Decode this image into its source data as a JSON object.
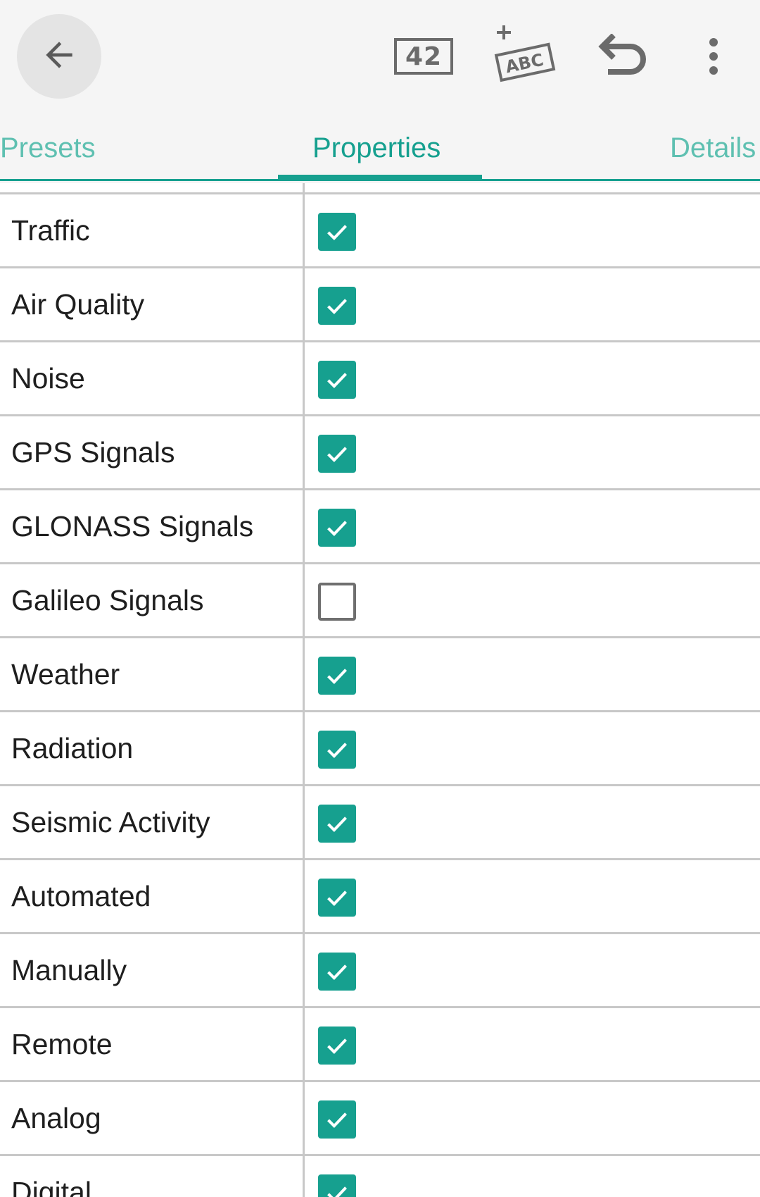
{
  "toolbar": {
    "back_icon": "arrow-left-icon",
    "number_badge": "42",
    "add_label_text": "ABC",
    "add_label_icon": "add-text-icon",
    "undo_icon": "undo-icon",
    "overflow_icon": "more-vert-icon"
  },
  "tabs": [
    {
      "label": "Presets",
      "active": false
    },
    {
      "label": "Properties",
      "active": true
    },
    {
      "label": "Details",
      "active": false
    }
  ],
  "properties": [
    {
      "label": "Traffic",
      "checked": true
    },
    {
      "label": "Air Quality",
      "checked": true
    },
    {
      "label": "Noise",
      "checked": true
    },
    {
      "label": "GPS Signals",
      "checked": true
    },
    {
      "label": "GLONASS Signals",
      "checked": true
    },
    {
      "label": "Galileo Signals",
      "checked": false
    },
    {
      "label": "Weather",
      "checked": true
    },
    {
      "label": "Radiation",
      "checked": true
    },
    {
      "label": "Seismic Activity",
      "checked": true
    },
    {
      "label": "Automated",
      "checked": true
    },
    {
      "label": "Manually",
      "checked": true
    },
    {
      "label": "Remote",
      "checked": true
    },
    {
      "label": "Analog",
      "checked": true
    },
    {
      "label": "Digital",
      "checked": true
    }
  ],
  "colors": {
    "accent": "#16a08f",
    "tab_inactive": "#5fc0b1",
    "divider": "#c8c8c8",
    "appbar_bg": "#f5f5f5"
  }
}
